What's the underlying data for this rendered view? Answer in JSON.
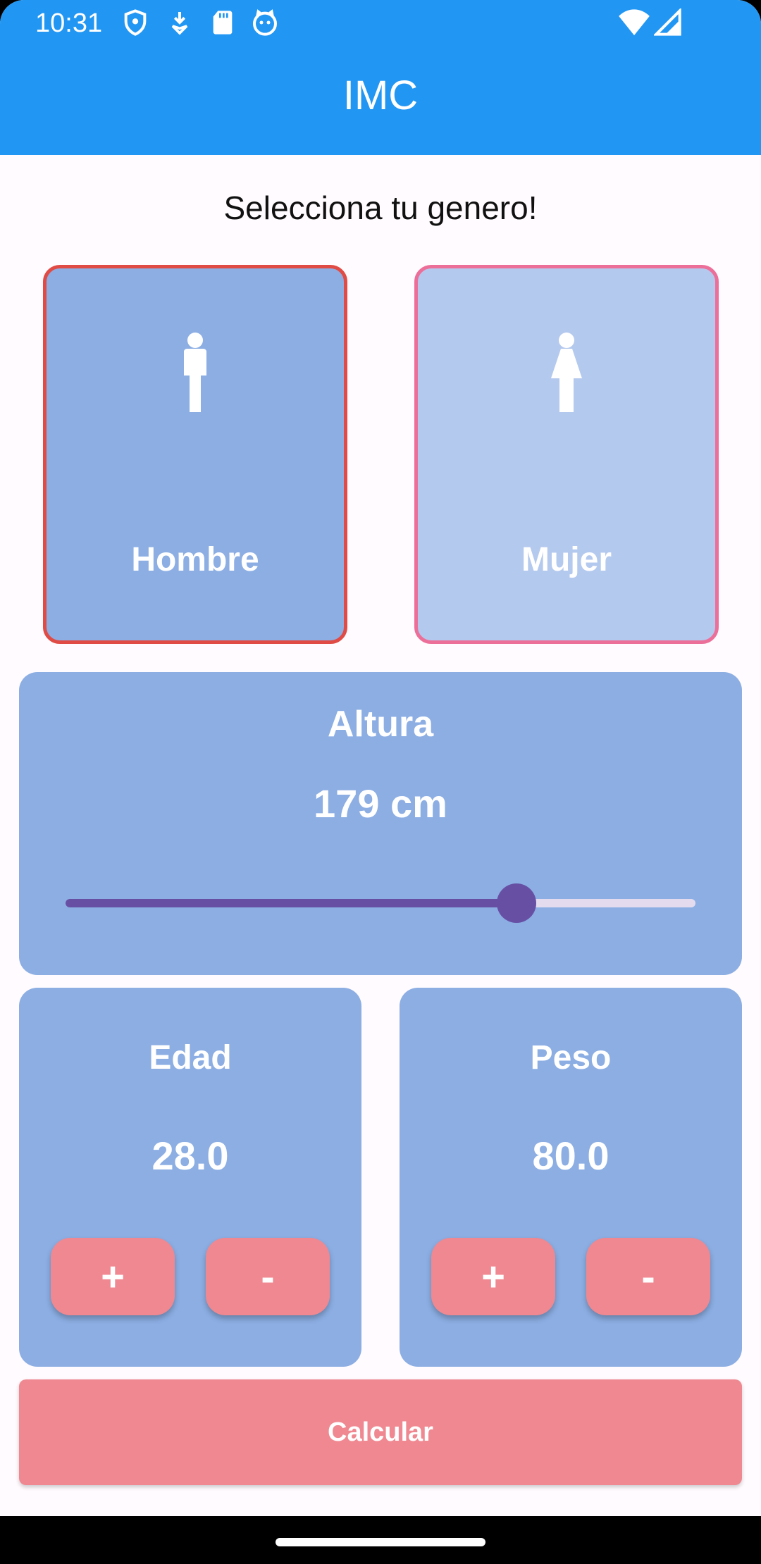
{
  "status_bar": {
    "time": "10:31",
    "left_icons": [
      "shield-icon",
      "download-icon",
      "sd-card-icon",
      "cat-face-icon"
    ],
    "right_icons": [
      "wifi-icon",
      "signal-icon"
    ]
  },
  "app_bar": {
    "title": "IMC",
    "color": "#2196f3"
  },
  "gender": {
    "prompt": "Selecciona tu genero!",
    "male_label": "Hombre",
    "female_label": "Mujer",
    "selected": "Hombre"
  },
  "height": {
    "title": "Altura",
    "value_text": "179 cm",
    "slider_fraction": 0.716
  },
  "age": {
    "title": "Edad",
    "value": "28.0",
    "plus_label": "+",
    "minus_label": "-"
  },
  "weight": {
    "title": "Peso",
    "value": "80.0",
    "plus_label": "+",
    "minus_label": "-"
  },
  "calculate_label": "Calcular",
  "colors": {
    "panel": "#8caee3",
    "accent_button": "#ef8890",
    "slider": "#6750a4",
    "male_border": "#e04b45",
    "female_border": "#ec6f9a"
  }
}
